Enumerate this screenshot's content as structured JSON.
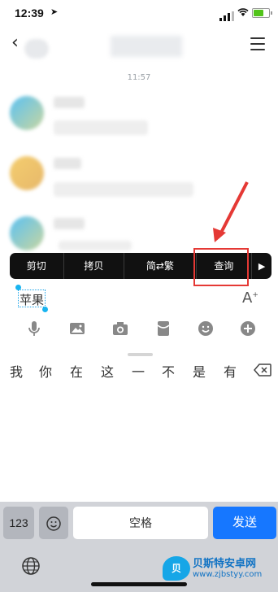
{
  "status_bar": {
    "time": "12:39",
    "location_icon": "location-arrow-icon",
    "battery_color": "#52c41a"
  },
  "header": {
    "timestamp": "11:57"
  },
  "context_menu": {
    "items": [
      "剪切",
      "拷贝",
      "简⇄繁",
      "查询"
    ],
    "more_arrow": "▶",
    "highlighted_item": "查询",
    "highlight_color": "#e53935"
  },
  "input": {
    "value": "苹果",
    "font_icon": "font-size-icon"
  },
  "toolbar": {
    "icons": [
      "microphone-icon",
      "image-icon",
      "camera-icon",
      "red-envelope-icon",
      "emoji-icon",
      "plus-icon"
    ]
  },
  "keyboard": {
    "candidates": [
      "我",
      "你",
      "在",
      "这",
      "一",
      "不",
      "是",
      "有"
    ],
    "delete_icon": "backspace-icon",
    "num_key": "123",
    "space_key": "空格",
    "send_key": "发送",
    "send_color": "#1677ff",
    "globe_icon": "globe-icon"
  },
  "watermark": {
    "logo": "贝",
    "title": "贝斯特安卓网",
    "url": "www.zjbstyy.com"
  }
}
